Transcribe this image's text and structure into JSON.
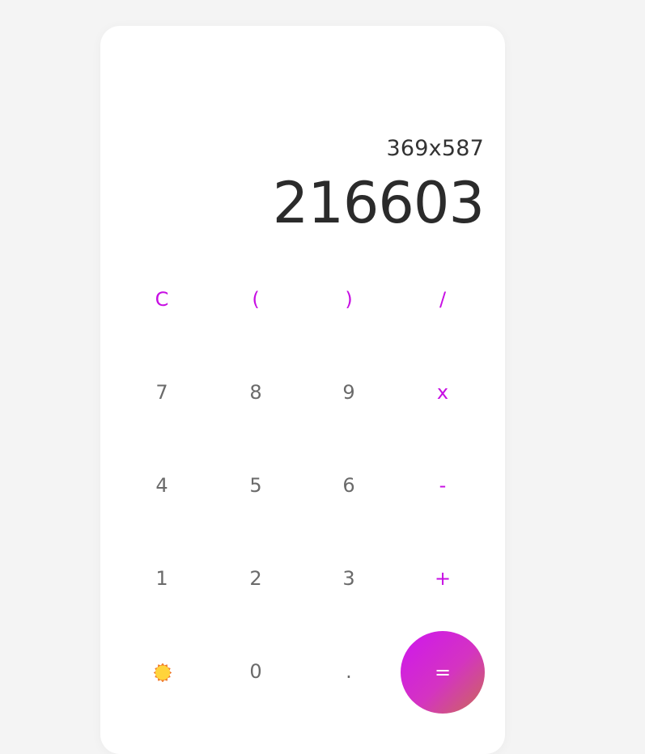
{
  "display": {
    "expression": "369x587",
    "result": "216603"
  },
  "keys": {
    "clear": "C",
    "open_paren": "(",
    "close_paren": ")",
    "divide": "/",
    "seven": "7",
    "eight": "8",
    "nine": "9",
    "multiply": "x",
    "four": "4",
    "five": "5",
    "six": "6",
    "subtract": "-",
    "one": "1",
    "two": "2",
    "three": "3",
    "add": "+",
    "zero": "0",
    "decimal": ".",
    "equals": "="
  },
  "theme_toggle": {
    "icon": "sun-icon"
  },
  "colors": {
    "background": "#f4f4f4",
    "panel": "#ffffff",
    "operator": "#c70ee3",
    "digit": "#6a6a6a",
    "equals_gradient_start": "#cf16ef",
    "equals_gradient_end": "#cb6b55",
    "sun_fill": "#ffd43b",
    "sun_stroke": "#f07a2a"
  }
}
